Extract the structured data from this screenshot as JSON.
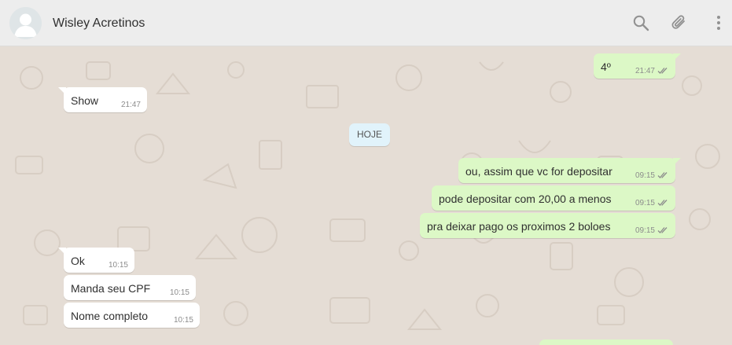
{
  "header": {
    "contact_name": "Wisley Acretinos",
    "icons": [
      "avatar",
      "search-icon",
      "paperclip-icon",
      "menu-dots-icon"
    ]
  },
  "day_separator": "HOJE",
  "messages": [
    {
      "direction": "out",
      "text": "4º",
      "time": "21:47",
      "status": "read"
    },
    {
      "direction": "in",
      "text": "Show",
      "time": "21:47"
    },
    {
      "direction": "out",
      "text": "ou, assim que vc for depositar",
      "time": "09:15",
      "status": "read"
    },
    {
      "direction": "out",
      "text": "pode depositar com 20,00 a menos",
      "time": "09:15",
      "status": "read"
    },
    {
      "direction": "out",
      "text": "pra deixar pago os proximos 2 boloes",
      "time": "09:15",
      "status": "read"
    },
    {
      "direction": "in",
      "text": "Ok",
      "time": "10:15"
    },
    {
      "direction": "in",
      "text": "Manda seu CPF",
      "time": "10:15"
    },
    {
      "direction": "in",
      "text": "Nome completo",
      "time": "10:15"
    }
  ],
  "colors": {
    "header_bg": "#ededed",
    "chat_bg": "#e5ddd5",
    "incoming_bubble": "#ffffff",
    "outgoing_bubble": "#dcf8c6",
    "day_separator_bg": "#e1f3fb",
    "tick_color": "#8c8c8c"
  }
}
